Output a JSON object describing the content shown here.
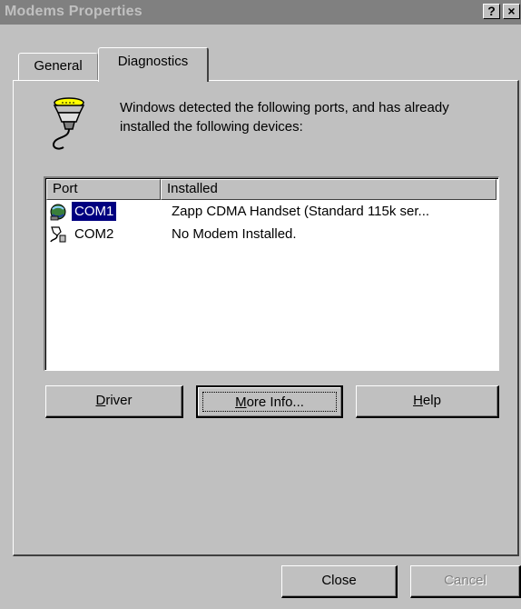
{
  "window": {
    "title": "Modems Properties",
    "help_button": "?",
    "close_button": "×"
  },
  "tabs": [
    {
      "label": "General",
      "active": false
    },
    {
      "label": "Diagnostics",
      "active": true
    }
  ],
  "info": {
    "icon": "serial-port-icon",
    "text": "Windows detected the following ports, and has already installed the following devices:"
  },
  "ports_list": {
    "columns": [
      "Port",
      "Installed"
    ],
    "rows": [
      {
        "port": "COM1",
        "installed": "Zapp CDMA Handset (Standard 115k ser...",
        "icon": "modem-icon",
        "selected": true
      },
      {
        "port": "COM2",
        "installed": "No Modem Installed.",
        "icon": "port-icon",
        "selected": false
      }
    ]
  },
  "action_buttons": {
    "driver": {
      "prefix": "",
      "mnemonic": "D",
      "rest": "river"
    },
    "more_info": {
      "prefix": "",
      "mnemonic": "M",
      "rest": "ore Info..."
    },
    "help": {
      "prefix": "",
      "mnemonic": "H",
      "rest": "elp"
    }
  },
  "footer": {
    "close": "Close",
    "cancel": "Cancel"
  },
  "colors": {
    "face": "#c0c0c0",
    "selection": "#000080",
    "titlebar_inactive": "#808080"
  }
}
